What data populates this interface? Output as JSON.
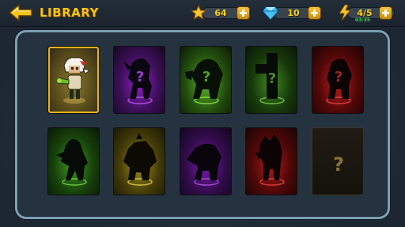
{
  "header": {
    "title": "LIBRARY",
    "stars": "64",
    "gems": "10",
    "energy": "4/5",
    "energy_timer": "03:35"
  },
  "colors": {
    "title": "#f6c31a",
    "green": "#39c23a",
    "purple": "#9a2bd8",
    "red": "#d42020",
    "yellow": "#c7b21a"
  },
  "cards": [
    {
      "name": "unlocked-hero",
      "glow": "yellow",
      "locked": false,
      "selected": true
    },
    {
      "name": "purple-zombie",
      "glow": "purple",
      "locked": true
    },
    {
      "name": "green-hulk",
      "glow": "green",
      "locked": true
    },
    {
      "name": "green-block",
      "glow": "green",
      "locked": true
    },
    {
      "name": "red-brute",
      "glow": "red",
      "locked": true
    },
    {
      "name": "green-walker",
      "glow": "green",
      "locked": true
    },
    {
      "name": "yellow-ogre",
      "glow": "yellow",
      "locked": true
    },
    {
      "name": "purple-crawler",
      "glow": "purple",
      "locked": true
    },
    {
      "name": "red-spiker",
      "glow": "red",
      "locked": true
    },
    {
      "name": "empty-slot",
      "glow": "none",
      "locked": true
    }
  ]
}
